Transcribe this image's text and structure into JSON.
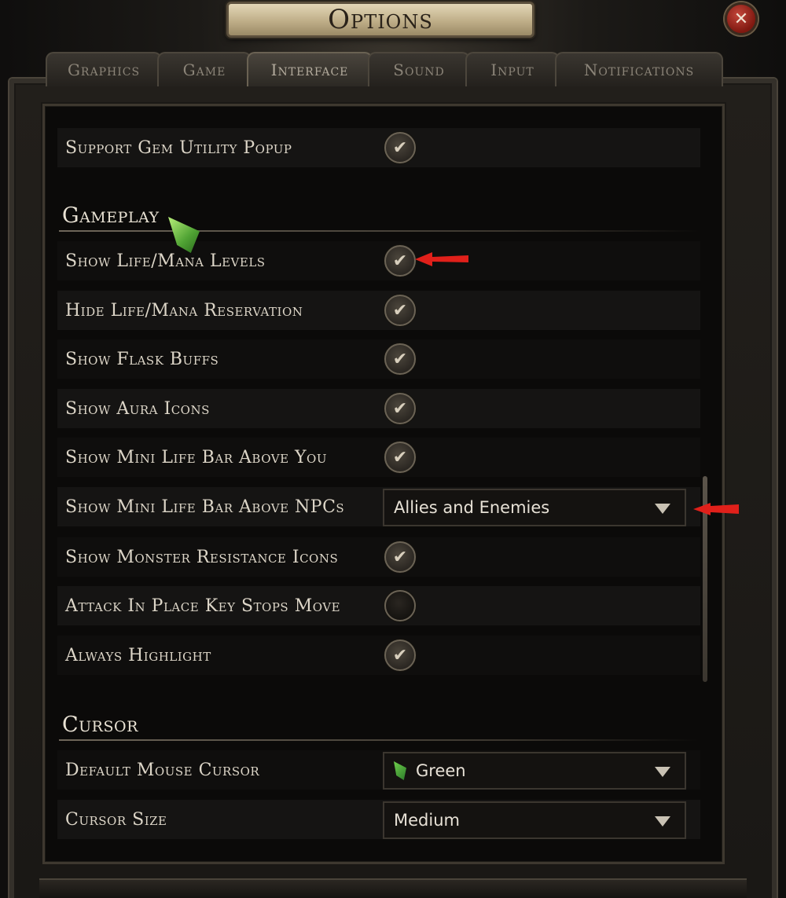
{
  "window": {
    "title": "Options",
    "close_glyph": "✕"
  },
  "tabs": [
    {
      "label": "Graphics",
      "active": false
    },
    {
      "label": "Game",
      "active": false
    },
    {
      "label": "Interface",
      "active": true
    },
    {
      "label": "Sound",
      "active": false
    },
    {
      "label": "Input",
      "active": false
    },
    {
      "label": "Notifications",
      "active": false
    }
  ],
  "top_row": {
    "label": "Support Gem Utility Popup",
    "checked": true
  },
  "sections": {
    "gameplay": {
      "title": "Gameplay",
      "rows": [
        {
          "label": "Show Life/Mana Levels",
          "checked": true
        },
        {
          "label": "Hide Life/Mana Reservation",
          "checked": true
        },
        {
          "label": "Show Flask Buffs",
          "checked": true
        },
        {
          "label": "Show Aura Icons",
          "checked": true
        },
        {
          "label": "Show Mini Life Bar Above You",
          "checked": true
        },
        {
          "label": "Show Mini Life Bar Above NPCs",
          "dropdown": "Allies and Enemies"
        },
        {
          "label": "Show Monster Resistance Icons",
          "checked": true
        },
        {
          "label": "Attack In Place Key Stops Move",
          "checked": false
        },
        {
          "label": "Always Highlight",
          "checked": true
        }
      ]
    },
    "cursor": {
      "title": "Cursor",
      "rows": [
        {
          "label": "Default Mouse Cursor",
          "dropdown": "Green",
          "icon": "green-cursor-icon"
        },
        {
          "label": "Cursor Size",
          "dropdown": "Medium"
        }
      ]
    }
  },
  "icons": {
    "check": "checkmark-icon",
    "dropdown_arrow": "chevron-down-icon"
  },
  "colors": {
    "annotation_arrow": "#e0201a",
    "cursor_green": "#4fa233"
  },
  "check_glyph": "✔"
}
